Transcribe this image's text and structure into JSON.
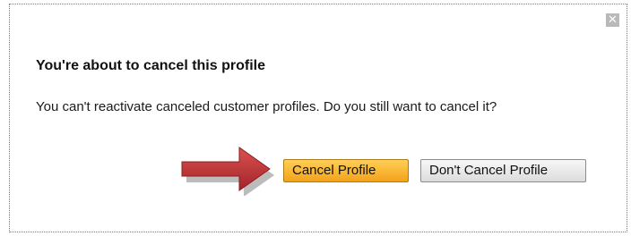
{
  "dialog": {
    "close_glyph": "✕",
    "title": "You're about to cancel this profile",
    "message": "You can't reactivate canceled customer profiles. Do you still want to cancel it?",
    "primary_button": "Cancel Profile",
    "secondary_button": "Don't Cancel Profile"
  },
  "colors": {
    "primary_button": "#f6b131",
    "arrow": "#c0392b"
  }
}
